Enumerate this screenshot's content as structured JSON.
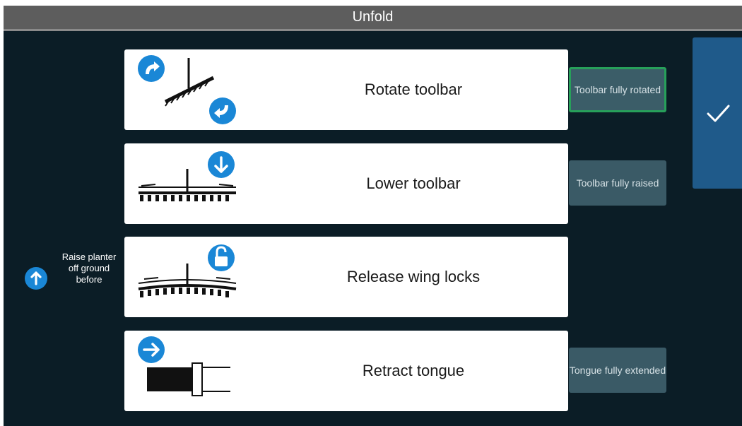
{
  "window": {
    "title": "Unfold"
  },
  "side_note": {
    "text": "Raise planter off ground before",
    "icon": "arrow-up-icon"
  },
  "steps": [
    {
      "label": "Rotate toolbar",
      "status": "Toolbar fully rotated",
      "status_active": true,
      "icon": "rotate-icon"
    },
    {
      "label": "Lower toolbar",
      "status": "Toolbar fully raised",
      "status_active": false,
      "icon": "arrow-down-icon"
    },
    {
      "label": "Release wing locks",
      "status": "",
      "status_active": false,
      "icon": "unlock-icon"
    },
    {
      "label": "Retract tongue",
      "status": "Tongue fully extended",
      "status_active": false,
      "icon": "arrow-right-icon"
    }
  ],
  "confirm": {
    "icon": "checkmark-icon"
  },
  "colors": {
    "accent_blue": "#1a87d6",
    "active_green": "#27a05a",
    "background": "#0b1d26",
    "status_bg": "#3a5a66",
    "confirm_bg": "#1f5a8a"
  }
}
